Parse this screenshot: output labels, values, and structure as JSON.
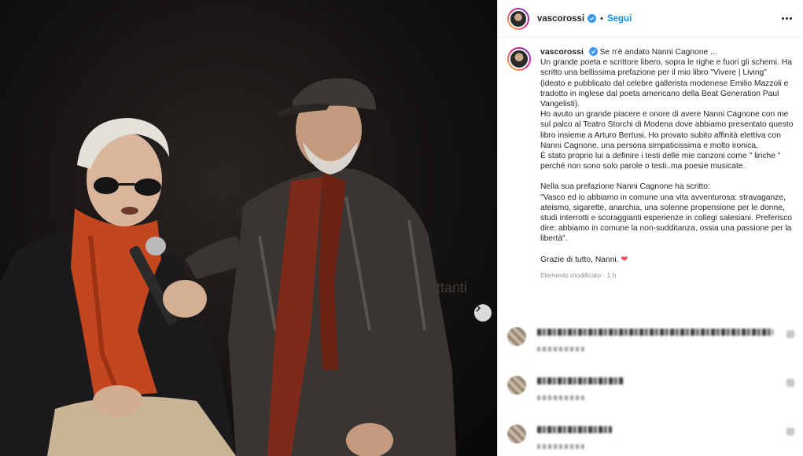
{
  "photo": {
    "alt": "",
    "backdrop_text": "ttanti"
  },
  "header": {
    "username": "vascorossi",
    "separator": "•",
    "follow_label": "Segui"
  },
  "caption": {
    "username": "vascorossi",
    "title": "Se n'è andato Nanni Cagnone ...",
    "paragraphs": [
      "Un grande poeta e scrittore libero, sopra le righe e fuori gli schemi. Ha scritto una bellissima prefazione per il mio libro \"Vivere | Living\" (ideato e pubblicato dal celebre gallerista modenese Emilio Mazzoli e tradotto in inglese dal poeta americano della Beat Generation Paul Vangelisti).",
      "Ho avuto un grande piacere e onore di avere Nanni Cagnone con me sul palco al Teatro Storchi di Modena dove abbiamo presentato questo libro insieme a Arturo Bertusi. Ho provato subito affinità elettiva con Nanni Cagnone, una persona simpaticissima e molto ironica.",
      "È stato proprio lui a definire i testi delle mie canzoni come \" liriche \" perché non sono solo parole o testi..ma poesie musicate."
    ],
    "paragraph_2": "Nella sua prefazione Nanni Cagnone ha scritto:",
    "quote": "\"Vasco ed io abbiamo in comune una vita avventurosa: stravaganze, ateismo, sigarette, anarchia, una solenne propensione per le donne, studi interrotti e scoraggianti esperienze in collegi salesiani. Preferisco dire: abbiamo in comune la non-sudditanza, ossia una passione per la libertà\".",
    "closing": "Grazie di tutto, Nanni.",
    "closing_emoji": "❤",
    "meta": "Elemento modificato · 1 h"
  },
  "colors": {
    "accent": "#0095f6",
    "verified": "#3897f0",
    "heart": "#ed4956"
  },
  "icons": {
    "verified": "verified-badge-icon",
    "more": "more-horizontal-icon",
    "next": "chevron-right-icon"
  }
}
